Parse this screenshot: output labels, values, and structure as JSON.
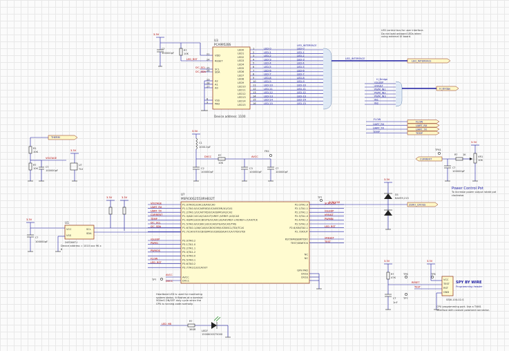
{
  "sheet": {
    "u3": {
      "designator": "U3",
      "part": "PCA9952BS",
      "addr_note": "Device address: 1100",
      "pins_left": [
        "VDD",
        "RESET",
        "SCL",
        "SDA",
        "A2",
        "A1",
        "A0",
        "VSS",
        "PAD"
      ],
      "pin_nums_left": [
        "21",
        "24",
        "25",
        "26",
        "29",
        "28",
        "27",
        "8",
        "9"
      ],
      "pins_right": [
        "LED0",
        "LED1",
        "LED2",
        "LED3",
        "LED4",
        "LED5",
        "LED6",
        "LED7",
        "LED8",
        "LED9",
        "LED10",
        "LED11",
        "LED12",
        "LED13",
        "LED14",
        "LED15"
      ],
      "net_left": [
        "I2C_SCL",
        "I2C_SDA"
      ],
      "rst_net": "LED_RST",
      "cap": "C?",
      "cap_val": "100000pF",
      "res": "R?",
      "res_val": "10K",
      "vcc": "3.3V"
    },
    "led_bus": {
      "title": "LED_INTERFACE",
      "nets": [
        "LED-0",
        "LED-1",
        "LED-2",
        "LED-3",
        "LED-4",
        "LED-5",
        "LED-6",
        "LED-7",
        "LED-8",
        "LED-9",
        "LED-10",
        "LED-11",
        "LED-12",
        "LED-13",
        "LED-14",
        "LED-15"
      ],
      "out_label": "LED_INTERFACE",
      "flag": "LED_INTERFACE"
    },
    "led_note": "LED control bus for user interface. Do not load onboard LEDs when using external UI board.",
    "hbridge": {
      "title": "H_Bridge",
      "nets": [
        "nSLEEP",
        "nFAULT",
        "PWM_IN1",
        "PWM_IN2",
        "PWM_IN3",
        "IN1",
        "IN2"
      ],
      "flag": "H_Bridge"
    },
    "misc_nets": {
      "flow": "FLOW",
      "uart_rx": "UART_RX",
      "uart_tx": "UART_TX",
      "temp": "TEMP",
      "labels": [
        "FLOW",
        "UART_RX",
        "UART_TX",
        "TEMP"
      ]
    },
    "therm": {
      "flag": "THERM",
      "r1": "R1",
      "r1v": "10K",
      "r2": "R?",
      "r2v": "10K",
      "r3": "R?",
      "r3v": "5K",
      "c": "C?",
      "cv": "100000pF",
      "net": "VOLTAGE",
      "u": "U?",
      "uv": "TLV",
      "vcc": "3.3V"
    },
    "power": {
      "vcc": "3.3V",
      "lbl": "DVCC",
      "lbl2": "AVCC",
      "r": "R?",
      "rv": "10K",
      "c1": "C1",
      "c1v": "1000.0pF",
      "c2": "C2",
      "c2v": "100000pF",
      "c3": "C3",
      "c3v": "100000pF",
      "c4": "C?",
      "c4v": "100000pF",
      "fb": "FB1",
      "ferrite": "6.8uH"
    },
    "pot": {
      "tp": "TP41",
      "net": "CURRENT",
      "r": "R?",
      "rv": "1K",
      "c": "C?",
      "cv": "100000pF",
      "vr": "VR1",
      "vrv": "10K",
      "title": "Power Control Pot",
      "sub": "To increase power output rotate pot clockwise."
    },
    "mcu": {
      "designator": "U?",
      "part": "MSP430G2553IRHB32T",
      "left_pins": [
        "P1.0/TA0CLK/ACLK/A0/CA0",
        "P1.1/TA0.0/UCA0RXD/UCA0SOMI/A1/CA1",
        "P1.2/TA0.1/UCA0TXD/UCA0SIMO/A2/CA2",
        "P1.3/ADC10CLK/CAOUT/VREF-/VEREF-/A3/CA3",
        "P1.4/SMCLK/UCB0STE/UCA0CLK/A4/VREF+/VEREF+/CA4/TCK",
        "P1.5/TA0.0/UCB0CLK/UCA0STE/A5/CA5/TMS",
        "P1.6/TA0.1/A6/CA6/UCB0SOMI/UCB0SCL/TDI/TCLK",
        "P1.7/CAOUT/UCB0SIMO/UCB0SDA/A7/CA7/TDO/TDI",
        "P3.0/TA0.2",
        "P3.1/TA1.0",
        "P3.2/TA1.1",
        "P3.3/TA1.2",
        "P3.4/TA0.0",
        "P3.5/TA0.1",
        "P3.6/TA0.2",
        "P3.7/TA1CLK/CAOUT",
        "AVCC",
        "DVCC"
      ],
      "left_nets": [
        "VOLTAGE",
        "UART_RX",
        "UART_TX",
        "CURRENT",
        "TEMP",
        "I2C_SCL",
        "I2C_SDA",
        "",
        "nSLEEP",
        "PWM1",
        "",
        "PWMOS",
        "",
        "FLOW",
        "LED_RST",
        "",
        ""
      ],
      "right_pins": [
        "P2.0/TA1.0",
        "P2.1/TA1.1",
        "P2.2/TA1.1",
        "P2.3/TA1.0",
        "P2.4/TA1.2",
        "P2.5/TA1.2",
        "P2.6/XIN/TA0.1",
        "P2.7/XOUT",
        "RST/NMI/SBWTDIO",
        "TEST/SBWTCK",
        "NC",
        "NC",
        "QFN PAD",
        "DVSS",
        "DVSS"
      ],
      "right_nets": [
        "SCROOM",
        "",
        "nSLEEP",
        "nFAULT",
        "PWMIN",
        "",
        "LED_RST",
        "",
        "nRESET",
        "TEST"
      ],
      "tp": "TP?",
      "tp2": "TP?"
    },
    "u1": {
      "designator": "U1",
      "part": "24FC64T-I",
      "note": "Device address = 1010 xxx 9K x 8",
      "pins": [
        "VCC",
        "VSS",
        "SCL",
        "SDA"
      ],
      "c": "C?",
      "cv": "100000pF",
      "vcc": "3.3V"
    },
    "diodes": {
      "d1": "D1",
      "d1v": "BAV99,215",
      "vcc": "3.3V",
      "net": "ZERO_CROSS",
      "net2": "SCROOM"
    },
    "spy": {
      "title": "SPY BY WIRE",
      "sub": "Programming header",
      "conn": "J?",
      "conn_part": "SSW-104-02-S",
      "r": "R?",
      "rv": "47K",
      "c": "C?",
      "cv": "1nF",
      "tp": "TP6",
      "tp2": "TP7",
      "tp3": "TP8",
      "net1": "RESET",
      "net2": "TEST",
      "vcc": "3.3V",
      "pin_labels": [
        "VCC",
        "TEST",
        "RST",
        "GND"
      ],
      "note": "CPU programming port. Use a TI461 interface with custom polarized connector."
    },
    "heartbeat": {
      "note": "Heartbeat LED is used for monitoring system status. It flashes at a nominal 500mS ON/OFF duty cycle when the CPU is running code normally.",
      "net": "LED_HB",
      "r": "R?",
      "rv": "360R",
      "led": "LED?",
      "ledv": "150060GS75000"
    }
  }
}
